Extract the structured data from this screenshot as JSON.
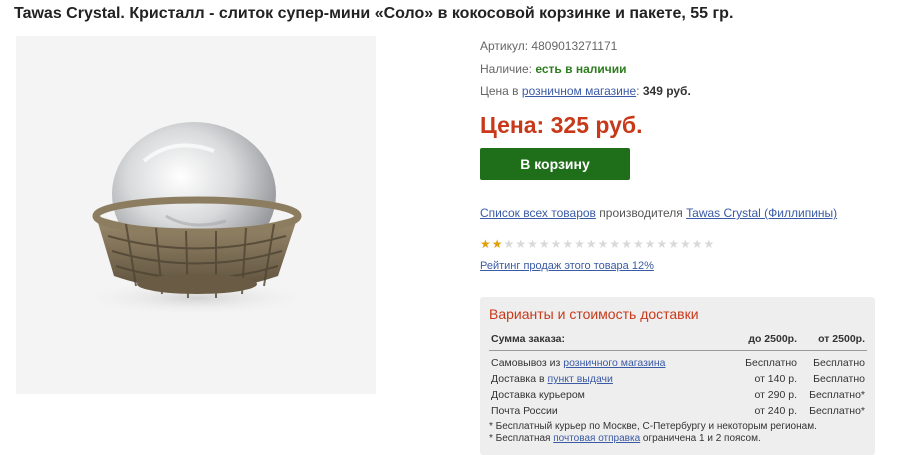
{
  "product": {
    "title": "Tawas Crystal. Кристалл - слиток супер-мини «Соло» в кокосовой корзинке и пакете, 55 гр."
  },
  "info": {
    "article_label": "Артикул:",
    "article_value": "4809013271171",
    "availability_label": "Наличие:",
    "availability_value": "есть в наличии",
    "retail_prefix": "Цена в",
    "retail_link": "розничном магазине",
    "retail_colon": ":",
    "retail_price": "349 руб.",
    "price": "Цена: 325 руб.",
    "cart_button": "В корзину",
    "maker_link": "Список всех товаров",
    "maker_text": "производителя",
    "maker_name": "Tawas Crystal (Филлипины)",
    "rating_filled": 2,
    "rating_total": 20,
    "rating_link": "Рейтинг продаж этого товара 12%"
  },
  "delivery": {
    "title": "Варианты и стоимость доставки",
    "headers": [
      "Сумма заказа:",
      "до 2500р.",
      "от 2500р."
    ],
    "rows": [
      {
        "label_prefix": "Самовывоз из",
        "label_link": "розничного магазина",
        "up_to": "Бесплатно",
        "from": "Бесплатно"
      },
      {
        "label_prefix": "Доставка в",
        "label_link": "пункт выдачи",
        "up_to": "от 140 р.",
        "from": "Бесплатно"
      },
      {
        "label_prefix": "Доставка курьером",
        "label_link": "",
        "up_to": "от 290 р.",
        "from": "Бесплатно*"
      },
      {
        "label_prefix": "Почта России",
        "label_link": "",
        "up_to": "от 240 р.",
        "from": "Бесплатно*"
      }
    ],
    "note1": "* Бесплатный курьер по Москве, С-Петербургу и некоторым регионам.",
    "note2_prefix": "* Бесплатная",
    "note2_link": "почтовая отправка",
    "note2_suffix": "ограничена 1 и 2 поясом."
  },
  "colors": {
    "price": "#c8391a",
    "button": "#1e6e1a",
    "link": "#3a5aa5",
    "availability": "#2e7d1f",
    "star_on": "#e1a000"
  }
}
